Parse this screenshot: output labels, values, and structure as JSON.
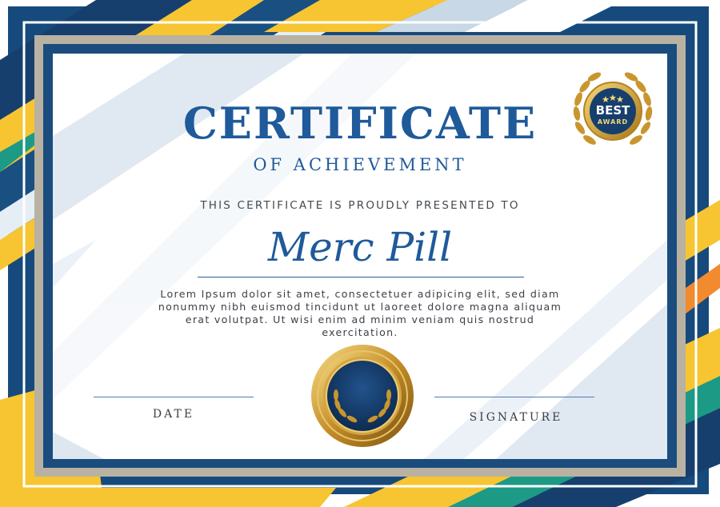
{
  "certificate": {
    "title": "CERTIFICATE",
    "subtitle": "OF ACHIEVEMENT",
    "presented_text": "THIS CERTIFICATE IS PROUDLY PRESENTED TO",
    "recipient_name": "Merc Pill",
    "body_text": "Lorem Ipsum dolor sit amet, consectetuer adipicing elit, sed diam nonummy nibh euismod tincidunt ut laoreet dolore magna aliquam erat volutpat. Ut wisi enim ad minim veniam quis nostrud exercitation.",
    "date_label": "DATE",
    "signature_label": "SIGNATURE"
  },
  "badge": {
    "line1": "BEST",
    "line2": "AWARD"
  },
  "colors": {
    "navy": "#163f6e",
    "blue": "#1f5a9a",
    "yellow": "#f7c531",
    "teal": "#1c9a86",
    "gold": "#c9962e",
    "frame_gray": "#b9b2a3"
  },
  "icons": [
    "star-icon",
    "laurel-icon",
    "seal-medallion-icon"
  ]
}
